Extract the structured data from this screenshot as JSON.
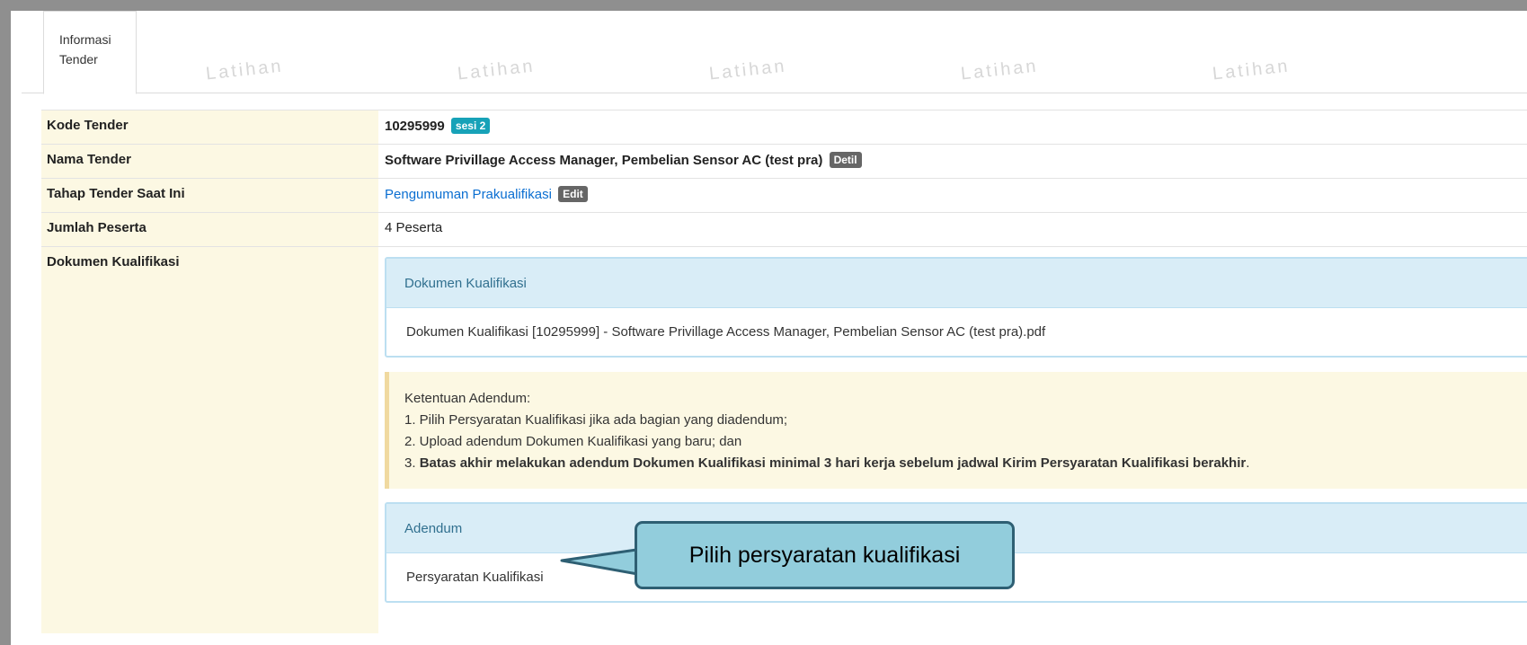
{
  "tabs": [
    {
      "label_line1": "Informasi",
      "label_line2": "Tender"
    }
  ],
  "watermark": "Latihan",
  "rows": {
    "kode": {
      "label": "Kode Tender",
      "value": "10295999",
      "badge": "sesi 2"
    },
    "nama": {
      "label": "Nama Tender",
      "value": "Software Privillage Access Manager, Pembelian Sensor AC (test pra)",
      "badge": "Detil"
    },
    "tahap": {
      "label": "Tahap Tender Saat Ini",
      "value": "Pengumuman Prakualifikasi",
      "badge": "Edit"
    },
    "jumlah": {
      "label": "Jumlah Peserta",
      "value": "4 Peserta"
    },
    "dokumen": {
      "label": "Dokumen Kualifikasi"
    }
  },
  "dokumen_panel": {
    "heading": "Dokumen Kualifikasi",
    "file": "Dokumen Kualifikasi [10295999] - Software Privillage Access Manager, Pembelian Sensor AC (test pra).pdf"
  },
  "ketentuan": {
    "title": "Ketentuan Adendum:",
    "item1": "1. Pilih Persyaratan Kualifikasi jika ada bagian yang diadendum;",
    "item2": "2. Upload adendum Dokumen Kualifikasi yang baru; dan",
    "item3_prefix": "3. ",
    "item3_bold": "Batas akhir melakukan adendum Dokumen Kualifikasi minimal 3 hari kerja sebelum jadwal Kirim Persyaratan Kualifikasi berakhir",
    "item3_suffix": "."
  },
  "adendum_panel": {
    "heading": "Adendum",
    "item": "Persyaratan Kualifikasi"
  },
  "callout": "Pilih persyaratan kualifikasi",
  "colors": {
    "label_bg": "#fcf8e3",
    "panel_head_bg": "#d9edf7",
    "panel_head_text": "#31708f",
    "badge_teal": "#17a2b8",
    "badge_gray": "#666666",
    "link": "#0a6ed1",
    "callout_bg": "#92cddc"
  }
}
